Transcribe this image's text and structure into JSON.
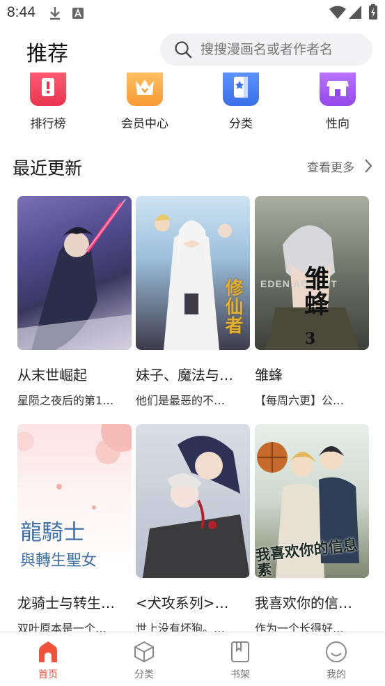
{
  "status_bar": {
    "time": "8:44"
  },
  "header": {
    "title": "推荐",
    "search_placeholder": "搜搜漫画名或者作者名"
  },
  "quick_entries": [
    {
      "label": "排行榜",
      "icon": "ranking-icon",
      "color": "#ef3f5c"
    },
    {
      "label": "会员中心",
      "icon": "vip-crown-icon",
      "color": "#f9a540"
    },
    {
      "label": "分类",
      "icon": "category-book-icon",
      "color": "#3f7df0"
    },
    {
      "label": "性向",
      "icon": "shop-icon",
      "color": "#a35bf0"
    }
  ],
  "recent": {
    "title": "最近更新",
    "more_label": "查看更多"
  },
  "comics": [
    {
      "title": "从末世崛起",
      "desc": "星陨之夜后的第1…"
    },
    {
      "title": "妹子、魔法与…",
      "desc": "他们是最恶的不…",
      "cover_text": "修仙者"
    },
    {
      "title": "雏蜂",
      "desc": "【每周六更】公…",
      "cover_text": "雏蜂",
      "cover_text2": "3",
      "cover_text3": "EDEN ADVENT"
    },
    {
      "title": "龙骑士与转生…",
      "desc": "双叶原本是一个…",
      "cover_text": "龍騎士",
      "cover_text2": "與轉生聖女"
    },
    {
      "title": "<犬攻系列>…",
      "desc": "世上没有坏狗。…"
    },
    {
      "title": "我喜欢你的信…",
      "desc": "作为一个长得好…",
      "cover_text": "我喜欢你的信息素"
    }
  ],
  "bottom_nav": [
    {
      "label": "首页",
      "icon": "home-icon",
      "active": true
    },
    {
      "label": "分类",
      "icon": "cube-icon"
    },
    {
      "label": "书架",
      "icon": "bookshelf-icon"
    },
    {
      "label": "我的",
      "icon": "profile-smile-icon"
    }
  ],
  "colors": {
    "accent": "#f0523a"
  }
}
